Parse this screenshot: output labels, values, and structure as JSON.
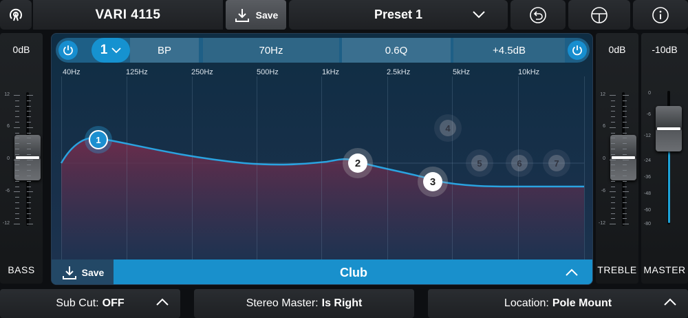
{
  "topbar": {
    "device_name": "VARI 4115",
    "save_label": "Save",
    "preset_name": "Preset 1"
  },
  "bass": {
    "value": "0dB",
    "label": "BASS",
    "scale": [
      "12",
      "6",
      "0",
      "-6",
      "-12"
    ]
  },
  "treble": {
    "value": "0dB",
    "label": "TREBLE",
    "scale": [
      "12",
      "6",
      "0",
      "-6",
      "-12"
    ]
  },
  "master": {
    "value": "-10dB",
    "label": "MASTER",
    "scale": [
      "0",
      "-6",
      "-12",
      "-24",
      "-36",
      "-48",
      "-60",
      "-80"
    ]
  },
  "eq": {
    "band_number": "1",
    "filter_type": "BP",
    "frequency": "70Hz",
    "q": "0.6Q",
    "gain": "+4.5dB",
    "freq_axis": [
      "40Hz",
      "125Hz",
      "250Hz",
      "500Hz",
      "1kHz",
      "2.5kHz",
      "5kHz",
      "10kHz"
    ],
    "nodes": [
      "1",
      "2",
      "3",
      "4",
      "5",
      "6",
      "7"
    ],
    "save_label": "Save",
    "curve_name": "Club"
  },
  "bottom": {
    "subcut_label": "Sub Cut:",
    "subcut_value": "OFF",
    "stereo_label": "Stereo Master:",
    "stereo_value": "Is Right",
    "location_label": "Location:",
    "location_value": "Pole Mount"
  },
  "colors": {
    "accent": "#1990cc",
    "curve": "#2aa3e0",
    "fill": "#6b2c4a"
  },
  "icons": [
    "broadcast-icon",
    "download-icon",
    "chevron-down-icon",
    "undo-icon",
    "steering-wheel-icon",
    "info-icon",
    "power-icon",
    "chevron-up-icon"
  ]
}
